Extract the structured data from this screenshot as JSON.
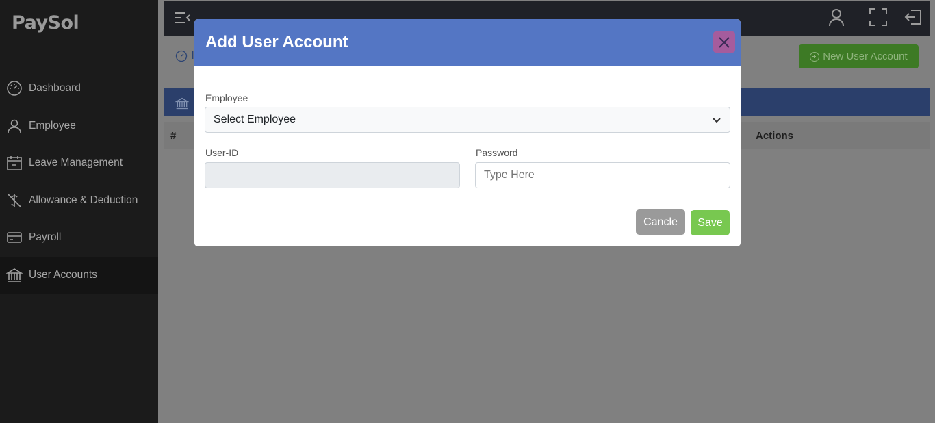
{
  "app": {
    "brand": "PaySol"
  },
  "sidebar": {
    "items": [
      {
        "label": "Dashboard",
        "icon": "gauge-icon"
      },
      {
        "label": "Employee",
        "icon": "user-icon"
      },
      {
        "label": "Leave Management",
        "icon": "calendar-icon"
      },
      {
        "label": "Allowance & Deduction",
        "icon": "dollar-slash-icon"
      },
      {
        "label": "Payroll",
        "icon": "credit-card-icon"
      },
      {
        "label": "User Accounts",
        "icon": "bank-icon",
        "active": true
      }
    ]
  },
  "page": {
    "breadcrumb_text": "I",
    "new_button_label": "New User Account",
    "table": {
      "headers": [
        "#",
        "Actions"
      ]
    }
  },
  "modal": {
    "title": "Add User Account",
    "employee_label": "Employee",
    "employee_select_value": "Select Employee",
    "userid_label": "User-ID",
    "userid_value": "",
    "password_label": "Password",
    "password_placeholder": "Type Here",
    "cancel_label": "Cancle",
    "save_label": "Save"
  },
  "colors": {
    "modal_header": "#5476c4",
    "close_button": "#a55c9d",
    "save_button": "#78c850",
    "cancel_button": "#9a9a9a",
    "sidebar_bg": "#1b1b1b"
  }
}
